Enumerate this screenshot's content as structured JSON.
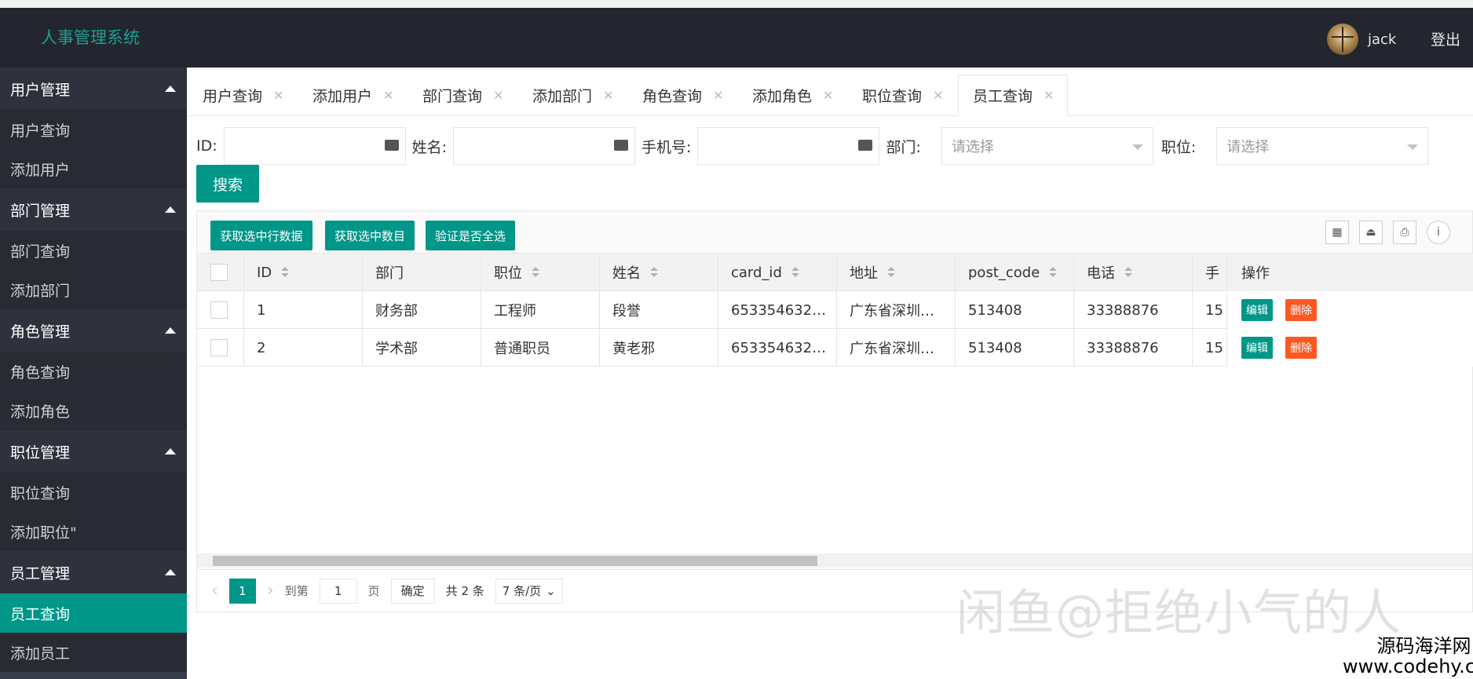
{
  "app": {
    "title": "人事管理系统",
    "user": "jack",
    "logout": "登出"
  },
  "sidebar": {
    "groups": [
      {
        "title": "用户管理",
        "items": [
          "用户查询",
          "添加用户"
        ]
      },
      {
        "title": "部门管理",
        "items": [
          "部门查询",
          "添加部门"
        ]
      },
      {
        "title": "角色管理",
        "items": [
          "角色查询",
          "添加角色"
        ]
      },
      {
        "title": "职位管理",
        "items": [
          "职位查询",
          "添加职位\""
        ]
      },
      {
        "title": "员工管理",
        "items": [
          "员工查询",
          "添加员工"
        ]
      }
    ],
    "active_item": "员工查询"
  },
  "tabs": [
    "用户查询",
    "添加用户",
    "部门查询",
    "添加部门",
    "角色查询",
    "添加角色",
    "职位查询",
    "员工查询"
  ],
  "active_tab": "员工查询",
  "filters": {
    "id_label": "ID:",
    "name_label": "姓名:",
    "phone_label": "手机号:",
    "dept_label": "部门:",
    "dept_placeholder": "请选择",
    "position_label": "职位:",
    "position_placeholder": "请选择",
    "search_button": "搜索"
  },
  "toolbar": {
    "btn_get_rows": "获取选中行数据",
    "btn_get_count": "获取选中数目",
    "btn_check_all": "验证是否全选",
    "icons": [
      "columns-icon",
      "export-icon",
      "print-icon",
      "info-icon"
    ]
  },
  "table": {
    "columns": [
      "ID",
      "部门",
      "职位",
      "姓名",
      "card_id",
      "地址",
      "post_code",
      "电话",
      "手"
    ],
    "ops_header": "操作",
    "rows": [
      {
        "id": "1",
        "dept": "财务部",
        "position": "工程师",
        "name": "段誉",
        "card_id": "653354632…",
        "address": "广东省深圳…",
        "post_code": "513408",
        "phone": "33388876",
        "mobile": "15"
      },
      {
        "id": "2",
        "dept": "学术部",
        "position": "普通职员",
        "name": "黄老邪",
        "card_id": "653354632…",
        "address": "广东省深圳…",
        "post_code": "513408",
        "phone": "33388876",
        "mobile": "15"
      }
    ],
    "edit_label": "编辑",
    "delete_label": "删除"
  },
  "pager": {
    "prev": "‹",
    "current": "1",
    "next": "›",
    "goto_label": "到第",
    "goto_value": "1",
    "page_unit": "页",
    "confirm": "确定",
    "total": "共 2 条",
    "page_size": "7 条/页"
  },
  "watermark": {
    "text1": "闲鱼@拒绝小气的人",
    "text2_line1": "源码海洋网",
    "text2_line2": "www.codehy.com"
  }
}
